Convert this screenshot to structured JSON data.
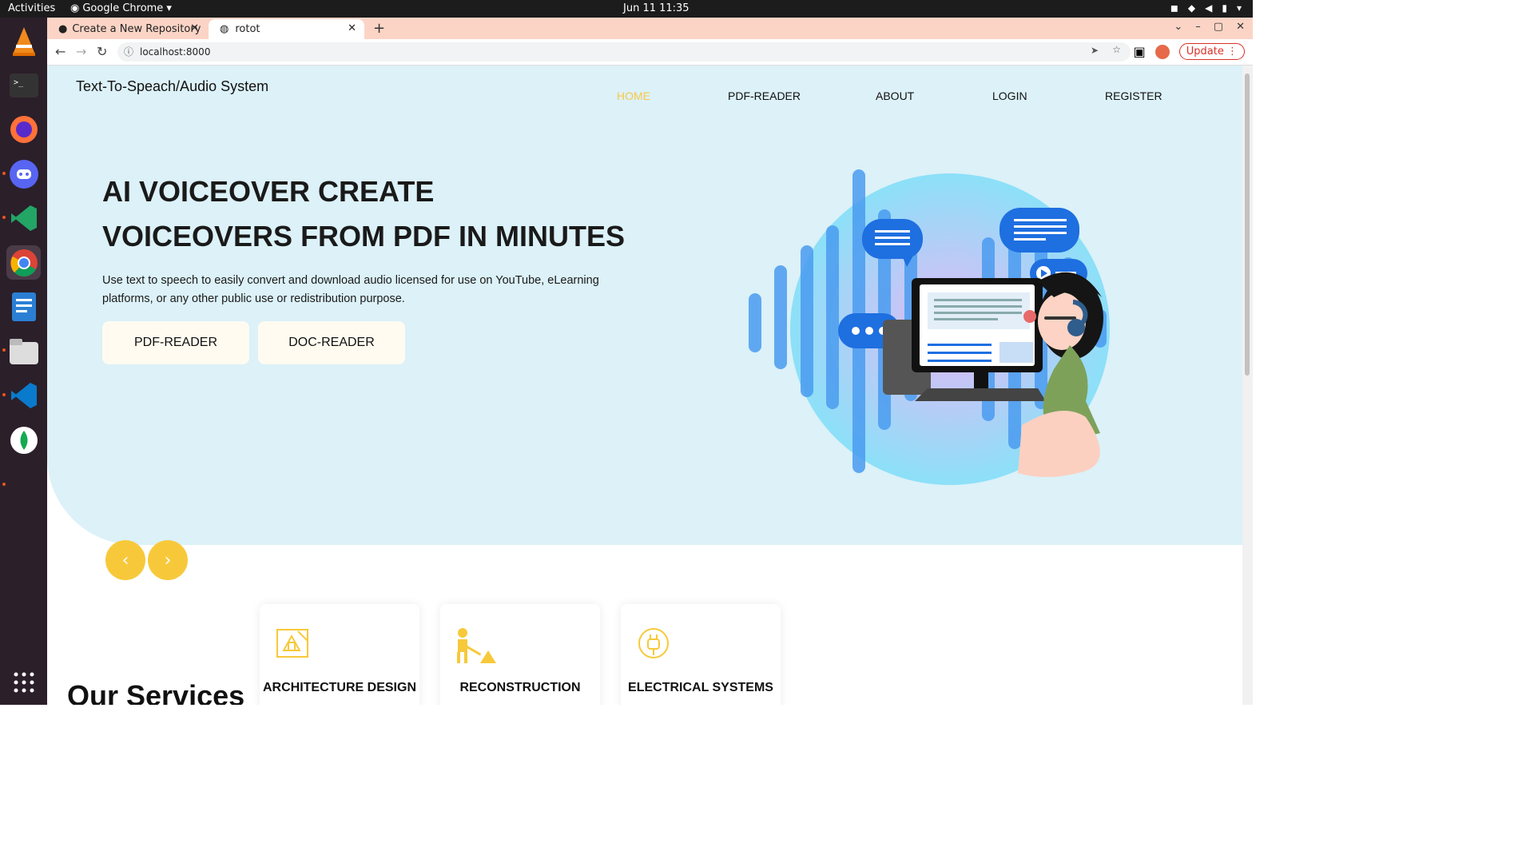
{
  "system": {
    "activities": "Activities",
    "app_name": "Google Chrome",
    "clock": "Jun 11  11:35"
  },
  "browser": {
    "tabs": [
      {
        "title": "Create a New Repository"
      },
      {
        "title": "rotot"
      }
    ],
    "url": "localhost:8000",
    "update_label": "Update"
  },
  "site": {
    "brand": "Text-To-Speach/Audio System",
    "nav": [
      "HOME",
      "PDF-READER",
      "ABOUT",
      "LOGIN",
      "REGISTER"
    ],
    "headline": "AI VOICEOVER CREATE VOICEOVERS FROM PDF IN MINUTES",
    "lead": "Use text to speech to easily convert and download audio licensed for use on YouTube, eLearning platforms, or any other public use or redistribution purpose.",
    "cta": [
      "PDF-READER",
      "DOC-READER"
    ],
    "services_title": "Our Services",
    "services": [
      "ARCHITECTURE DESIGN",
      "RECONSTRUCTION",
      "ELECTRICAL SYSTEMS"
    ],
    "accent": "#f7c948"
  }
}
